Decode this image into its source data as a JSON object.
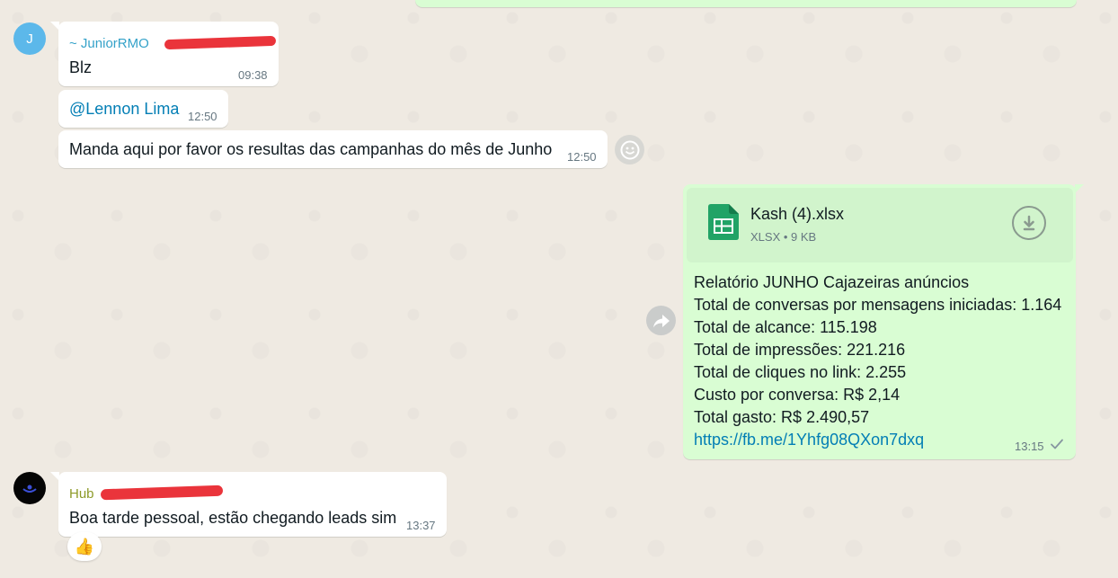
{
  "messages": {
    "m1": {
      "sender": "~ JuniorRMO",
      "text": "Blz",
      "time": "09:38",
      "avatar_letter": "J"
    },
    "m2": {
      "mention": "@Lennon Lima",
      "time": "12:50"
    },
    "m3": {
      "text": "Manda aqui por favor os resultas das campanhas do mês de Junho",
      "time": "12:50"
    },
    "m4": {
      "file_name": "Kash (4).xlsx",
      "file_meta": "XLSX • 9 KB",
      "lines": [
        "Relatório JUNHO Cajazeiras anúncios",
        "Total de conversas por mensagens iniciadas: 1.164",
        "Total de alcance: 115.198",
        "Total de impressões: 221.216",
        "Total de cliques no link: 2.255",
        "Custo por conversa: R$ 2,14",
        "Total gasto: R$ 2.490,57"
      ],
      "link": "https://fb.me/1Yhfg08QXon7dxq",
      "time": "13:15"
    },
    "m5": {
      "sender": "Hub",
      "text": "Boa tarde pessoal, estão chegando leads sim",
      "time": "13:37",
      "reaction": "👍"
    }
  },
  "icons": {
    "emoji": "emoji-react-icon",
    "forward": "forward-icon",
    "download": "download-icon",
    "sheet": "spreadsheet-file-icon",
    "check": "single-check-icon"
  },
  "colors": {
    "incoming": "#ffffff",
    "outgoing": "#d9fdd3",
    "junior_name": "#35a2c9",
    "hub_name": "#8d9a28",
    "link": "#027eb5",
    "sheet_green": "#21a366"
  }
}
